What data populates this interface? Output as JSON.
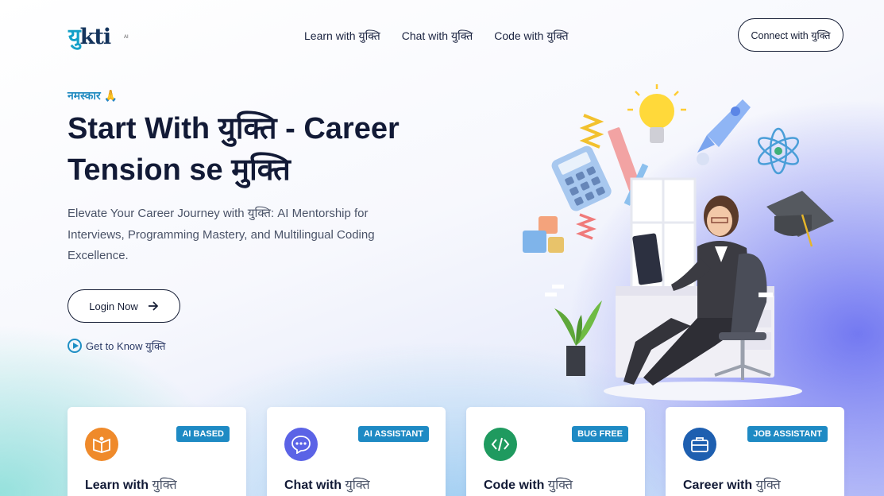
{
  "header": {
    "logo_text_1": "यु",
    "logo_text_2": "kti",
    "logo_sub": "AI",
    "nav": [
      "Learn with युक्ति",
      "Chat with युक्ति",
      "Code with युक्ति"
    ],
    "connect_label": "Connect with युक्ति"
  },
  "hero": {
    "greeting": "नमस्कार 🙏",
    "title": "Start With युक्ति - Career Tension se मुक्ति",
    "description": "Elevate Your Career Journey with युक्ति: AI Mentorship for Interviews, Programming Mastery, and Multilingual Coding Excellence.",
    "login_label": "Login Now",
    "get_know_label": "Get to Know युक्ति"
  },
  "cards": [
    {
      "badge": "AI BASED",
      "title_bold": "Learn with",
      "title_rest": " युक्ति",
      "icon": "book-open-icon",
      "color": "#ef8a2b"
    },
    {
      "badge": "AI ASSISTANT",
      "title_bold": "Chat with",
      "title_rest": " युक्ति",
      "icon": "chat-bubble-icon",
      "color": "#5b63e6"
    },
    {
      "badge": "BUG FREE",
      "title_bold": "Code with",
      "title_rest": " युक्ति",
      "icon": "code-icon",
      "color": "#1f9a5f"
    },
    {
      "badge": "JOB ASSISTANT",
      "title_bold": "Career with",
      "title_rest": " युक्ति",
      "icon": "briefcase-icon",
      "color": "#1e5fb0"
    }
  ]
}
